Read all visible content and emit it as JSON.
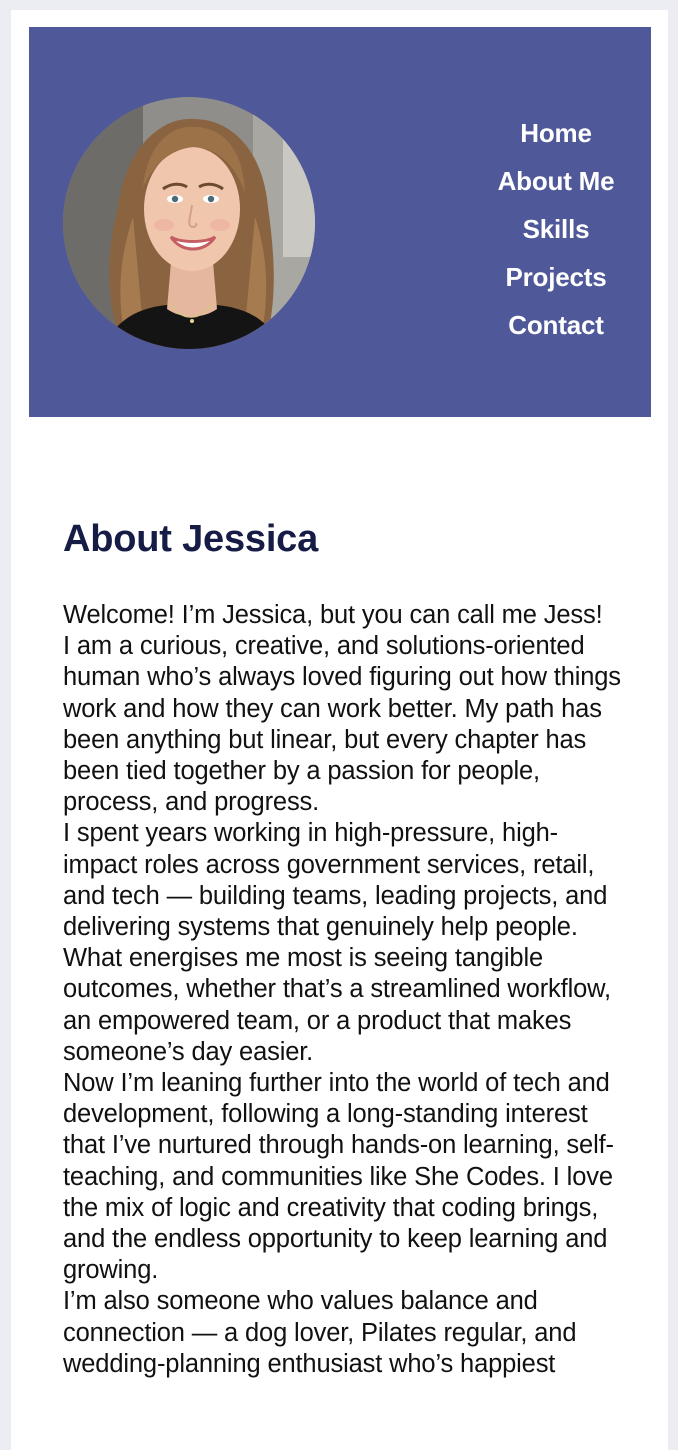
{
  "header": {
    "profile_photo_alt": "Jessica profile photo",
    "nav": [
      {
        "label": "Home"
      },
      {
        "label": "About Me"
      },
      {
        "label": "Skills"
      },
      {
        "label": "Projects"
      },
      {
        "label": "Contact"
      }
    ]
  },
  "about": {
    "title": "About Jessica",
    "paragraphs": [
      "Welcome! I’m Jessica, but you can call me Jess!",
      "I am a curious, creative, and solutions-oriented human who’s always loved figuring out how things work and how they can work better. My path has been anything but linear, but every chapter has been tied together by a passion for people, process, and progress.",
      "I spent years working in high-pressure, high-impact roles across government services, retail, and tech — building teams, leading projects, and delivering systems that genuinely help people. What energises me most is seeing tangible outcomes, whether that’s a streamlined workflow, an empowered team, or a product that makes someone’s day easier.",
      "Now I’m leaning further into the world of tech and development, following a long-standing interest that I’ve nurtured through hands-on learning, self-teaching, and communities like She Codes. I love the mix of logic and creativity that coding brings, and the endless opportunity to keep learning and growing.",
      "I’m also someone who values balance and connection — a dog lover, Pilates regular, and wedding-planning enthusiast who’s happiest"
    ]
  },
  "colors": {
    "header_bg": "#4f5899",
    "nav_text": "#ffffff",
    "title_text": "#161c45",
    "page_bg": "#ecedf3"
  }
}
